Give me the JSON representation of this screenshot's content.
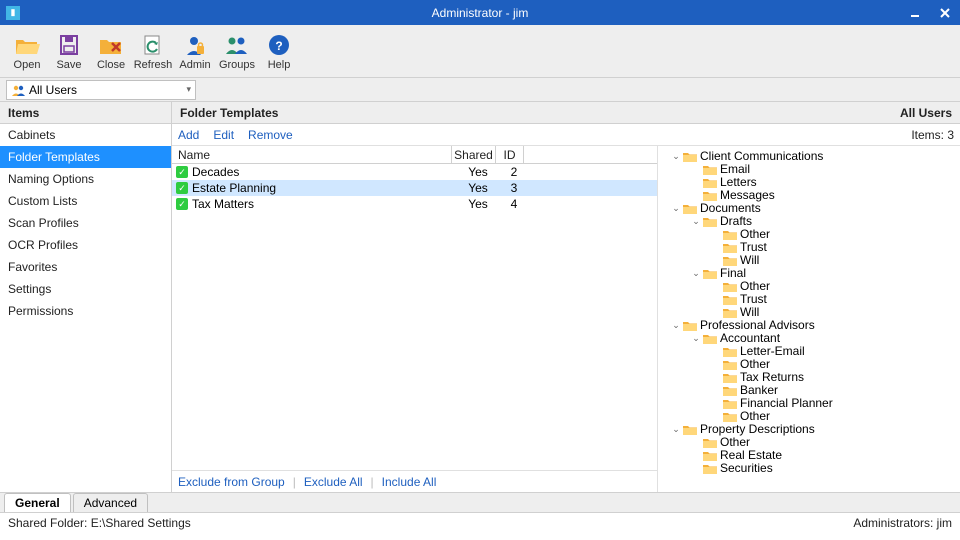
{
  "title": "Administrator - jim",
  "toolbar": [
    {
      "id": "open",
      "label": "Open",
      "color": "#f4b03a"
    },
    {
      "id": "save",
      "label": "Save",
      "color": "#7b3fa0"
    },
    {
      "id": "close",
      "label": "Close",
      "color": "#f4b03a"
    },
    {
      "id": "refresh",
      "label": "Refresh",
      "color": "#2b8f6b"
    },
    {
      "id": "admin",
      "label": "Admin",
      "color": "#1e5fbf"
    },
    {
      "id": "groups",
      "label": "Groups",
      "color": "#2b8f6b"
    },
    {
      "id": "help",
      "label": "Help",
      "color": "#1e5fbf"
    }
  ],
  "filter": {
    "label": "All Users"
  },
  "sidebar": {
    "header": "Items",
    "items": [
      {
        "label": "Cabinets"
      },
      {
        "label": "Folder Templates",
        "selected": true
      },
      {
        "label": "Naming Options"
      },
      {
        "label": "Custom Lists"
      },
      {
        "label": "Scan Profiles"
      },
      {
        "label": "OCR Profiles"
      },
      {
        "label": "Favorites"
      },
      {
        "label": "Settings"
      },
      {
        "label": "Permissions"
      }
    ]
  },
  "main": {
    "header_left": "Folder Templates",
    "header_right": "All Users",
    "actions": {
      "add": "Add",
      "edit": "Edit",
      "remove": "Remove"
    },
    "items_label": "Items: 3",
    "cols": {
      "name": "Name",
      "shared": "Shared",
      "id": "ID"
    },
    "rows": [
      {
        "name": "Decades",
        "shared": "Yes",
        "id": "2"
      },
      {
        "name": "Estate Planning",
        "shared": "Yes",
        "id": "3",
        "selected": true
      },
      {
        "name": "Tax Matters",
        "shared": "Yes",
        "id": "4"
      }
    ],
    "footer": {
      "exclude_group": "Exclude from Group",
      "exclude_all": "Exclude All",
      "include_all": "Include All"
    }
  },
  "tree": [
    {
      "d": 0,
      "tw": "v",
      "label": "Client Communications"
    },
    {
      "d": 1,
      "tw": "",
      "label": "Email"
    },
    {
      "d": 1,
      "tw": "",
      "label": "Letters"
    },
    {
      "d": 1,
      "tw": "",
      "label": "Messages"
    },
    {
      "d": 0,
      "tw": "v",
      "label": "Documents"
    },
    {
      "d": 1,
      "tw": "v",
      "label": "Drafts"
    },
    {
      "d": 2,
      "tw": "",
      "label": "Other"
    },
    {
      "d": 2,
      "tw": "",
      "label": "Trust"
    },
    {
      "d": 2,
      "tw": "",
      "label": "Will"
    },
    {
      "d": 1,
      "tw": "v",
      "label": "Final"
    },
    {
      "d": 2,
      "tw": "",
      "label": "Other"
    },
    {
      "d": 2,
      "tw": "",
      "label": "Trust"
    },
    {
      "d": 2,
      "tw": "",
      "label": "Will"
    },
    {
      "d": 0,
      "tw": "v",
      "label": "Professional Advisors"
    },
    {
      "d": 1,
      "tw": "v",
      "label": "Accountant"
    },
    {
      "d": 2,
      "tw": "",
      "label": "Letter-Email"
    },
    {
      "d": 2,
      "tw": "",
      "label": "Other"
    },
    {
      "d": 2,
      "tw": "",
      "label": "Tax Returns"
    },
    {
      "d": 2,
      "tw": "",
      "label": "Banker"
    },
    {
      "d": 2,
      "tw": "",
      "label": "Financial Planner"
    },
    {
      "d": 2,
      "tw": "",
      "label": "Other"
    },
    {
      "d": 0,
      "tw": "v",
      "label": "Property Descriptions"
    },
    {
      "d": 1,
      "tw": "",
      "label": "Other"
    },
    {
      "d": 1,
      "tw": "",
      "label": "Real Estate"
    },
    {
      "d": 1,
      "tw": "",
      "label": "Securities"
    }
  ],
  "tabs": {
    "general": "General",
    "advanced": "Advanced"
  },
  "status": {
    "left": "Shared Folder:  E:\\Shared Settings",
    "right": "Administrators:  jim"
  }
}
